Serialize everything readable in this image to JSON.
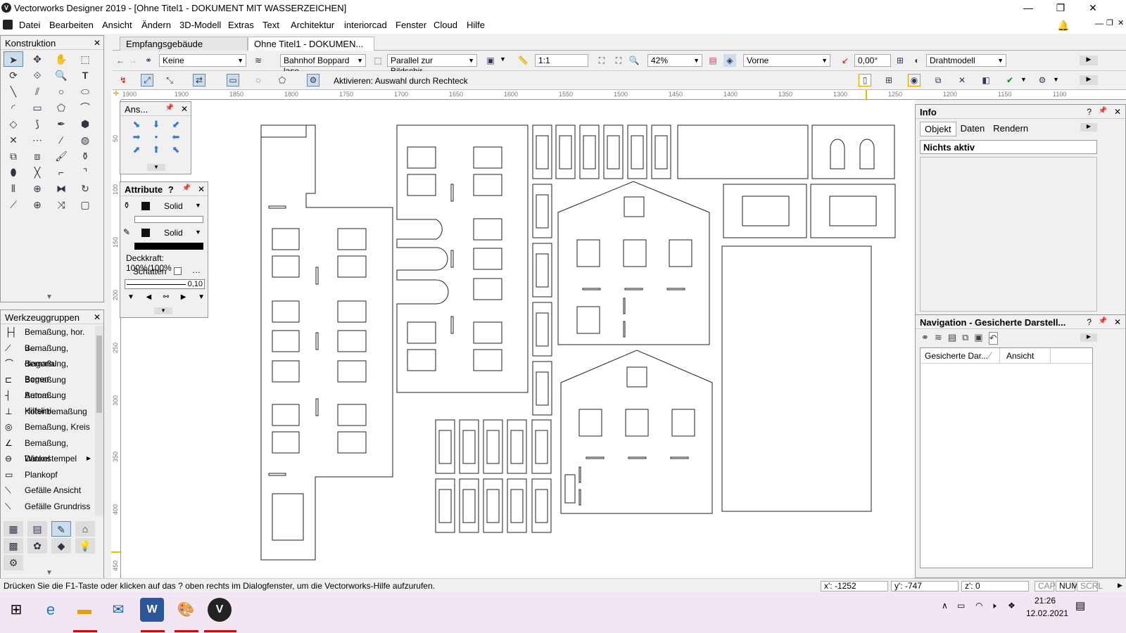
{
  "window": {
    "title": "Vectorworks Designer 2019 - [Ohne Titel1 - DOKUMENT MIT WASSERZEICHEN]",
    "minimize": "—",
    "maximize": "❐",
    "close": "✕"
  },
  "menu": [
    "Datei",
    "Bearbeiten",
    "Ansicht",
    "Ändern",
    "3D-Modell",
    "Extras",
    "Text",
    "Architektur",
    "interiorcad",
    "Fenster",
    "Cloud",
    "Hilfe"
  ],
  "tabs": [
    {
      "label": "Empfangsgebäude Boppard...."
    },
    {
      "label": "Ohne Titel1 - DOKUMEN...",
      "close": "✕"
    }
  ],
  "viewbar": {
    "class_select": "Keine",
    "layer_select": "Bahnhof Boppard lase",
    "projection": "Parallel zur Bildschir...",
    "scale": "1:1",
    "zoom": "42%",
    "view": "Vorne",
    "rotation": "0,00°",
    "render_mode": "Drahtmodell"
  },
  "modebar": {
    "mode_text": "Aktivieren: Auswahl durch Rechteck"
  },
  "ruler": {
    "top": [
      "1900",
      "1850",
      "1800",
      "1750",
      "1700",
      "1650",
      "1600",
      "1550",
      "1500",
      "1450",
      "1400",
      "1350",
      "1300",
      "1250",
      "1200",
      "1150",
      "1100"
    ],
    "left": [
      "50",
      "100",
      "150",
      "200",
      "250",
      "300",
      "350",
      "400",
      "450"
    ]
  },
  "tool_panel": {
    "title": "Konstruktion",
    "close": "✕"
  },
  "toolsets": {
    "title": "Werkzeuggruppen",
    "close": "✕",
    "items": [
      "Bemaßung, hor. u...",
      "Bemaßung, diagonal",
      "Bemaßung, Bogen",
      "Bemaßung Autom...",
      "Bemaßung Hilfslini...",
      "Kotenbemaßung",
      "Bemaßung, Kreis",
      "Bemaßung, Winkel",
      "Datenstempel",
      "Plankopf",
      "Gefälle Ansicht",
      "Gefälle Grundriss"
    ]
  },
  "ans_panel": {
    "title": "Ans...",
    "close": "✕"
  },
  "attr_panel": {
    "title": "Attribute",
    "help": "?",
    "close": "✕",
    "fill_style": "Solid",
    "pen_style": "Solid",
    "opacity": "Deckkraft: 100%/100%",
    "shadow": "Schatten",
    "line_weight": "0,10"
  },
  "info_panel": {
    "title": "Info",
    "help": "?",
    "close": "✕",
    "tabs": [
      "Objekt",
      "Daten",
      "Rendern"
    ],
    "status": "Nichts aktiv"
  },
  "nav_panel": {
    "title": "Navigation - Gesicherte Darstell...",
    "help": "?",
    "close": "✕",
    "col1": "Gesicherte Dar...",
    "col2": "Ansicht"
  },
  "status": {
    "hint": "Drücken Sie die F1-Taste oder klicken auf das ? oben rechts im Dialogfenster, um die Vectorworks-Hilfe aufzurufen.",
    "x": "x': -1252",
    "y": "y': -747",
    "z": "z': 0",
    "cap": "CAP",
    "num": "NUM",
    "scrl": "SCRL"
  },
  "taskbar": {
    "time": "21:26",
    "date": "12.02.2021"
  }
}
